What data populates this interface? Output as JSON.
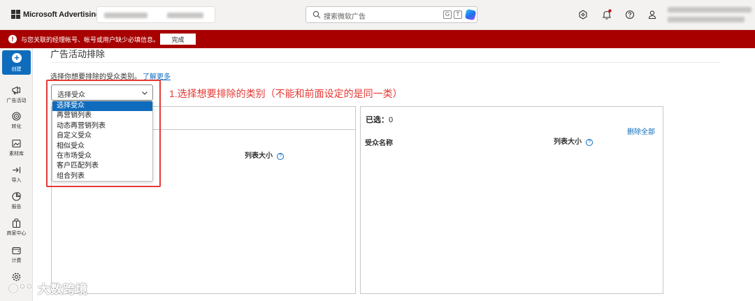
{
  "topbar": {
    "app_title": "Microsoft Advertising",
    "search_placeholder": "搜索微软广告",
    "search_shortcuts": [
      "G",
      "T"
    ]
  },
  "banner": {
    "message": "与您关联的经理帐号、帐号或用户缺少必填信息。",
    "button_label": "完成",
    "color": "#a80000"
  },
  "leftnav": {
    "create_label": "创建",
    "items": [
      {
        "label": "广告活动",
        "icon": "megaphone-icon"
      },
      {
        "label": "转化",
        "icon": "target-icon"
      },
      {
        "label": "素材库",
        "icon": "asset-library-icon"
      },
      {
        "label": "导入",
        "icon": "import-icon"
      },
      {
        "label": "报告",
        "icon": "report-icon"
      },
      {
        "label": "商家中心",
        "icon": "store-icon"
      },
      {
        "label": "计费",
        "icon": "wallet-icon"
      }
    ]
  },
  "main": {
    "page_title": "广告活动排除",
    "instruction": "选择你想要排除的受众类别。",
    "learn_more": "了解更多",
    "select": {
      "value": "选择受众",
      "options": [
        "选择受众",
        "再营销列表",
        "动态再营销列表",
        "自定义受众",
        "相似受众",
        "在市场受众",
        "客户匹配列表",
        "组合列表"
      ]
    },
    "annotation": "1.选择想要排除的类别（不能和前面设定的是同一类）",
    "left_panel": {
      "list_size_header": "列表大小"
    },
    "right_panel": {
      "selected_label": "已选：",
      "selected_count": "0",
      "remove_all": "删除全部",
      "audience_name_header": "受众名称",
      "list_size_header": "列表大小"
    }
  },
  "watermark": {
    "text": "大数跨境"
  },
  "colors": {
    "accent": "#0f6cbd",
    "annotation_red": "#e53935"
  }
}
